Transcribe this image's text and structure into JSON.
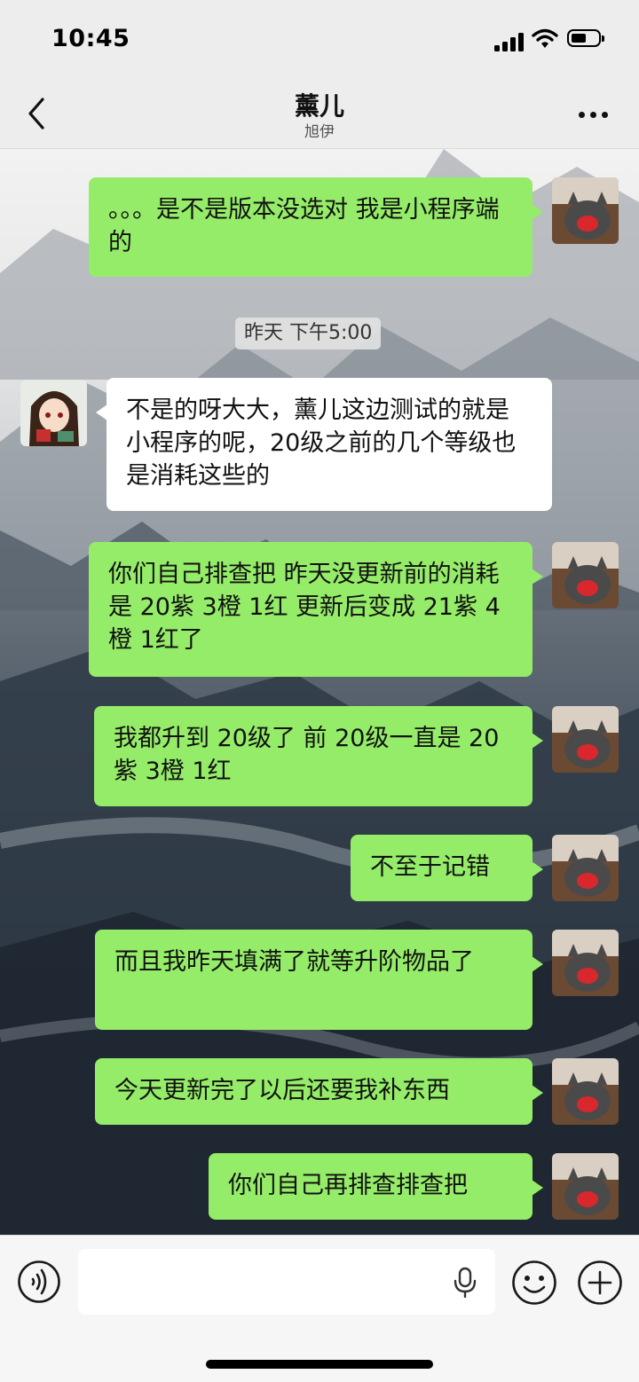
{
  "status_bar": {
    "time": "10:45",
    "battery_level_percent": 45
  },
  "header": {
    "title": "薰儿",
    "subtitle": "旭伊",
    "back_icon": "chevron-left-icon",
    "more_icon": "more-dots-icon"
  },
  "messages": [
    {
      "sender": "me",
      "text": "。。。是不是版本没选对 我是小程序端的"
    },
    {
      "type": "timestamp",
      "text": "昨天 下午5:00"
    },
    {
      "sender": "them",
      "text": "不是的呀大大，薰儿这边测试的就是小程序的呢，20级之前的几个等级也是消耗这些的"
    },
    {
      "sender": "me",
      "text": "你们自己排查把 昨天没更新前的消耗是 20紫 3橙 1红 更新后变成 21紫 4橙 1红了"
    },
    {
      "sender": "me",
      "text": "我都升到 20级了 前 20级一直是 20紫 3橙 1红"
    },
    {
      "sender": "me",
      "text": "不至于记错"
    },
    {
      "sender": "me",
      "text": "而且我昨天填满了就等升阶物品了"
    },
    {
      "sender": "me",
      "text": "今天更新完了以后还要我补东西"
    },
    {
      "sender": "me",
      "text": "你们自己再排查排查把"
    }
  ],
  "input_bar": {
    "voice_icon": "voice-mode-icon",
    "mic_icon": "microphone-icon",
    "emoji_icon": "emoji-icon",
    "plus_icon": "plus-icon",
    "text_value": ""
  },
  "colors": {
    "my_bubble": "#95ec69",
    "their_bubble": "#ffffff",
    "header_bg": "#ededed"
  }
}
